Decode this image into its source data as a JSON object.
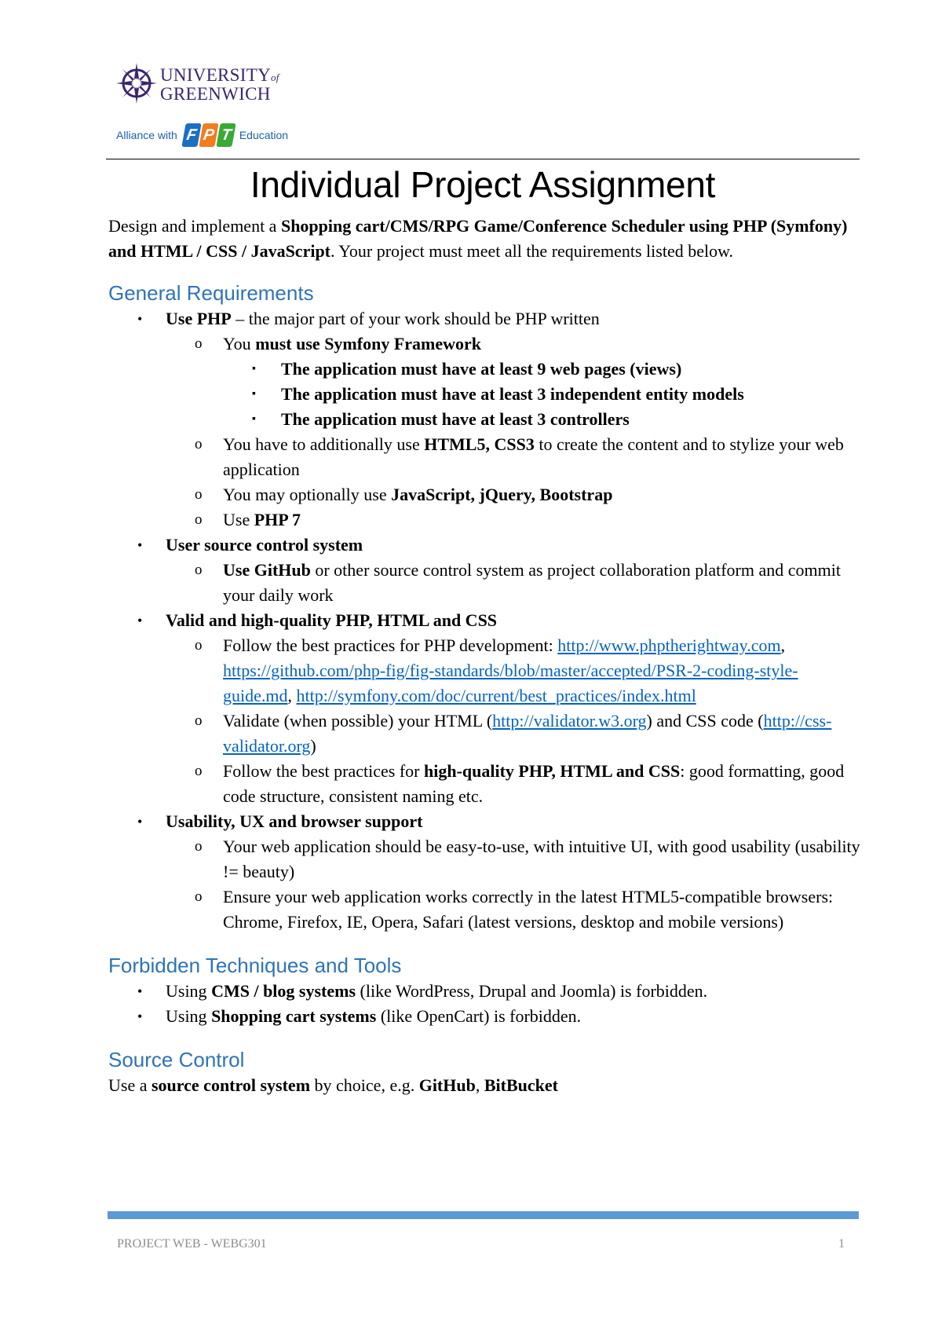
{
  "logo": {
    "university_line1": "UNIVERSITY",
    "university_of": "of",
    "university_line2": "GREENWICH",
    "alliance_prefix": "Alliance with",
    "fpt_letters": [
      "F",
      "P",
      "T"
    ],
    "alliance_suffix": "Education",
    "colors": {
      "university": "#3b2470",
      "fpt_f": "#1b6fc4",
      "fpt_p": "#f27c1e",
      "fpt_t": "#3aa935"
    }
  },
  "title": "Individual Project Assignment",
  "intro": {
    "t1": "Design and implement a ",
    "b1": "Shopping cart/CMS/RPG Game/Conference Scheduler using PHP (Symfony) and HTML / CSS / JavaScript",
    "t2": ". Your project must meet all the requirements listed below."
  },
  "sections": {
    "general": {
      "heading": "General Requirements",
      "php": {
        "bold": "Use PHP",
        "text": " – the major part of your work should be PHP written",
        "symfony": {
          "t": "You ",
          "b": "must use Symfony Framework"
        },
        "reqs": [
          "The application must have at least 9 web pages (views)",
          "The application must have at least 3 independent entity models",
          "The application must have at least 3 controllers"
        ],
        "html": {
          "t1": "You have to additionally use ",
          "b": "HTML5, CSS3",
          "t2": " to create the content and to stylize your web application"
        },
        "js": {
          "t": "You may optionally use ",
          "b": "JavaScript, jQuery, Bootstrap"
        },
        "php7": {
          "t": "Use ",
          "b": "PHP 7"
        }
      },
      "source": {
        "bold": "User source control system",
        "github": {
          "b": "Use GitHub",
          "t": " or other source control system as project collaboration platform and commit your daily work"
        }
      },
      "quality": {
        "bold": "Valid and high-quality PHP, HTML and CSS",
        "practices": {
          "t": "Follow the best practices for PHP development: ",
          "link1": "http://www.phptherightway.com",
          "sep1": ", ",
          "link2": "https://github.com/php-fig/fig-standards/blob/master/accepted/PSR-2-coding-style-guide.md",
          "sep2": ", ",
          "link3": "http://symfony.com/doc/current/best_practices/index.html"
        },
        "validate": {
          "t1": "Validate (when possible) your HTML (",
          "link1": "http://validator.w3.org",
          "t2": ") and CSS code (",
          "link2": "http://css-validator.org",
          "t3": ")"
        },
        "follow": {
          "t1": "Follow the best practices for ",
          "b": "high-quality PHP, HTML and CSS",
          "t2": ": good formatting, good code structure, consistent naming etc."
        }
      },
      "usability": {
        "bold": "Usability, UX and browser support",
        "items": [
          "Your web application should be easy-to-use, with intuitive UI, with good usability (usability != beauty)",
          "Ensure your web application works correctly in the latest HTML5-compatible browsers: Chrome, Firefox, IE, Opera, Safari (latest versions, desktop and mobile versions)"
        ]
      }
    },
    "forbidden": {
      "heading": "Forbidden Techniques and Tools",
      "items": [
        {
          "t1": "Using ",
          "b": "CMS / blog systems",
          "t2": " (like WordPress, Drupal and Joomla) is forbidden."
        },
        {
          "t1": "Using ",
          "b": "Shopping cart systems",
          "t2": " (like OpenCart) is forbidden."
        }
      ]
    },
    "source_control": {
      "heading": "Source Control",
      "t1": "Use a ",
      "b1": "source control system",
      "t2": " by choice, e.g. ",
      "b2": "GitHub",
      "t3": ", ",
      "b3": "BitBucket"
    }
  },
  "footer": {
    "left": "PROJECT WEB - WEBG301",
    "page_number": "1",
    "bar_color": "#5b9bd5"
  },
  "markers": {
    "bullet": "•",
    "circle": "o",
    "square": "▪"
  }
}
